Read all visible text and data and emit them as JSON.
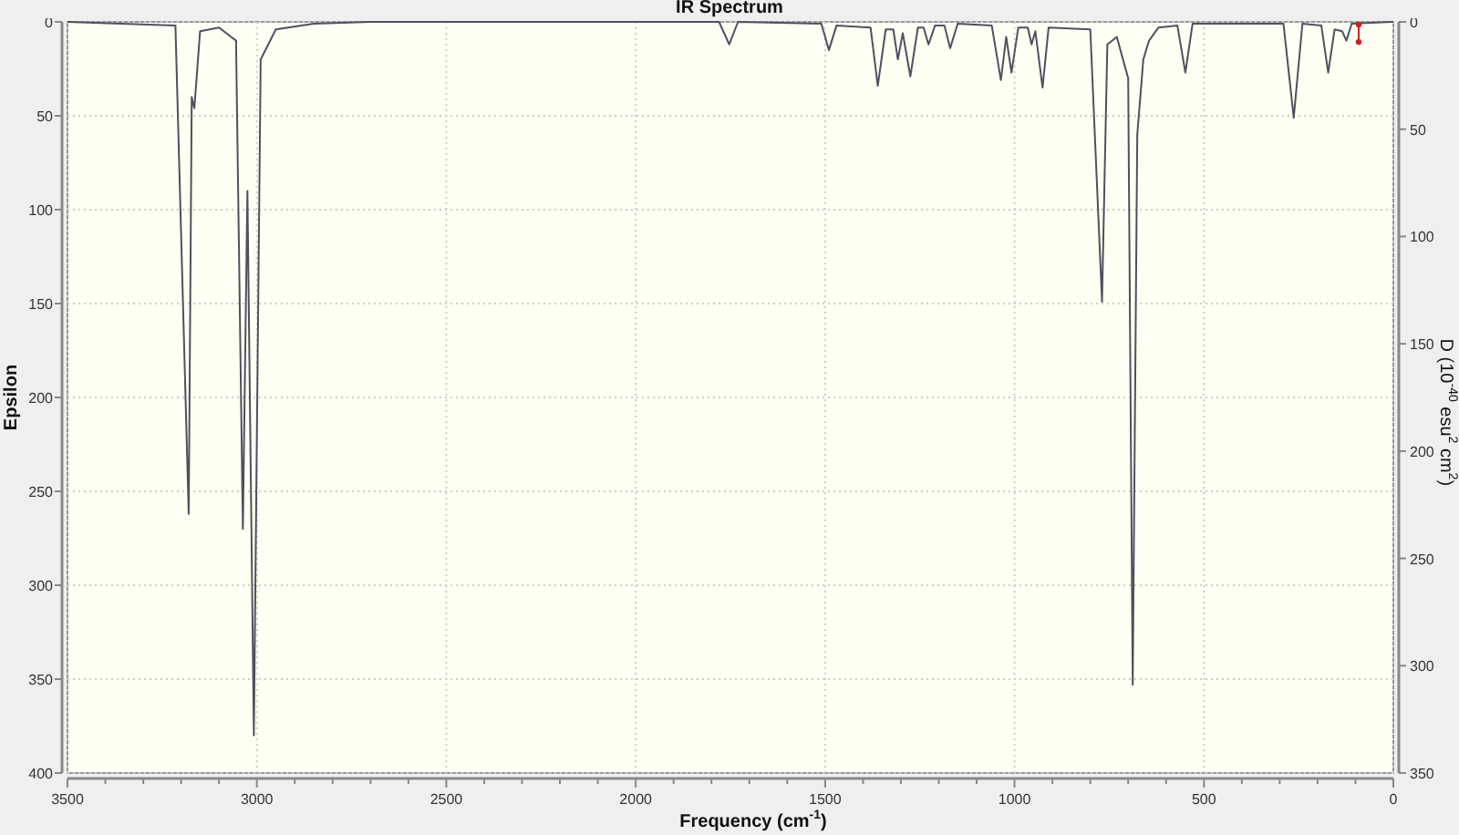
{
  "title": "IR Spectrum",
  "chart_data": {
    "type": "line",
    "xlabel": "Frequency (cm$^{-1}$)",
    "ylabel": "Epsilon",
    "y2label": "D (10$^{-40}$ esu$^{2}$ cm$^{2}$)",
    "x": [
      3500,
      3215,
      3180,
      3172,
      3165,
      3150,
      3100,
      3055,
      3037,
      3025,
      3008,
      2990,
      2950,
      2850,
      2700,
      1780,
      1753,
      1730,
      1510,
      1490,
      1470,
      1380,
      1361,
      1340,
      1320,
      1308,
      1295,
      1275,
      1255,
      1240,
      1227,
      1210,
      1185,
      1170,
      1150,
      1060,
      1036,
      1022,
      1008,
      990,
      965,
      955,
      945,
      926,
      910,
      800,
      769,
      755,
      730,
      700,
      688,
      676,
      672,
      660,
      645,
      620,
      570,
      549,
      530,
      290,
      263,
      240,
      190,
      172,
      155,
      135,
      124,
      110,
      0
    ],
    "series": [
      {
        "color": "#505060",
        "values": [
          0,
          2,
          262,
          40,
          46,
          5,
          3,
          10,
          270,
          90,
          380,
          20,
          4,
          1,
          0,
          0,
          12,
          0,
          1,
          15,
          2,
          3,
          34,
          4,
          4,
          20,
          6,
          29,
          3,
          3,
          12,
          2,
          2,
          14,
          1,
          2,
          31,
          8,
          27,
          3,
          3,
          12,
          5,
          35,
          3,
          4,
          149,
          12,
          8,
          30,
          353,
          60,
          50,
          20,
          10,
          3,
          2,
          27,
          1,
          1,
          51,
          1,
          2,
          27,
          4,
          5,
          10,
          1,
          0
        ]
      }
    ],
    "grid": true,
    "xlim": [
      3500,
      0
    ],
    "ylim": [
      400,
      0
    ],
    "y2lim": [
      350,
      0
    ],
    "xticks": [
      3500,
      3000,
      2500,
      2000,
      1500,
      1000,
      500,
      0
    ],
    "yticks": [
      0,
      50,
      100,
      150,
      200,
      250,
      300,
      350,
      400
    ],
    "y2ticks": [
      0,
      50,
      100,
      150,
      200,
      250,
      300,
      350
    ]
  }
}
